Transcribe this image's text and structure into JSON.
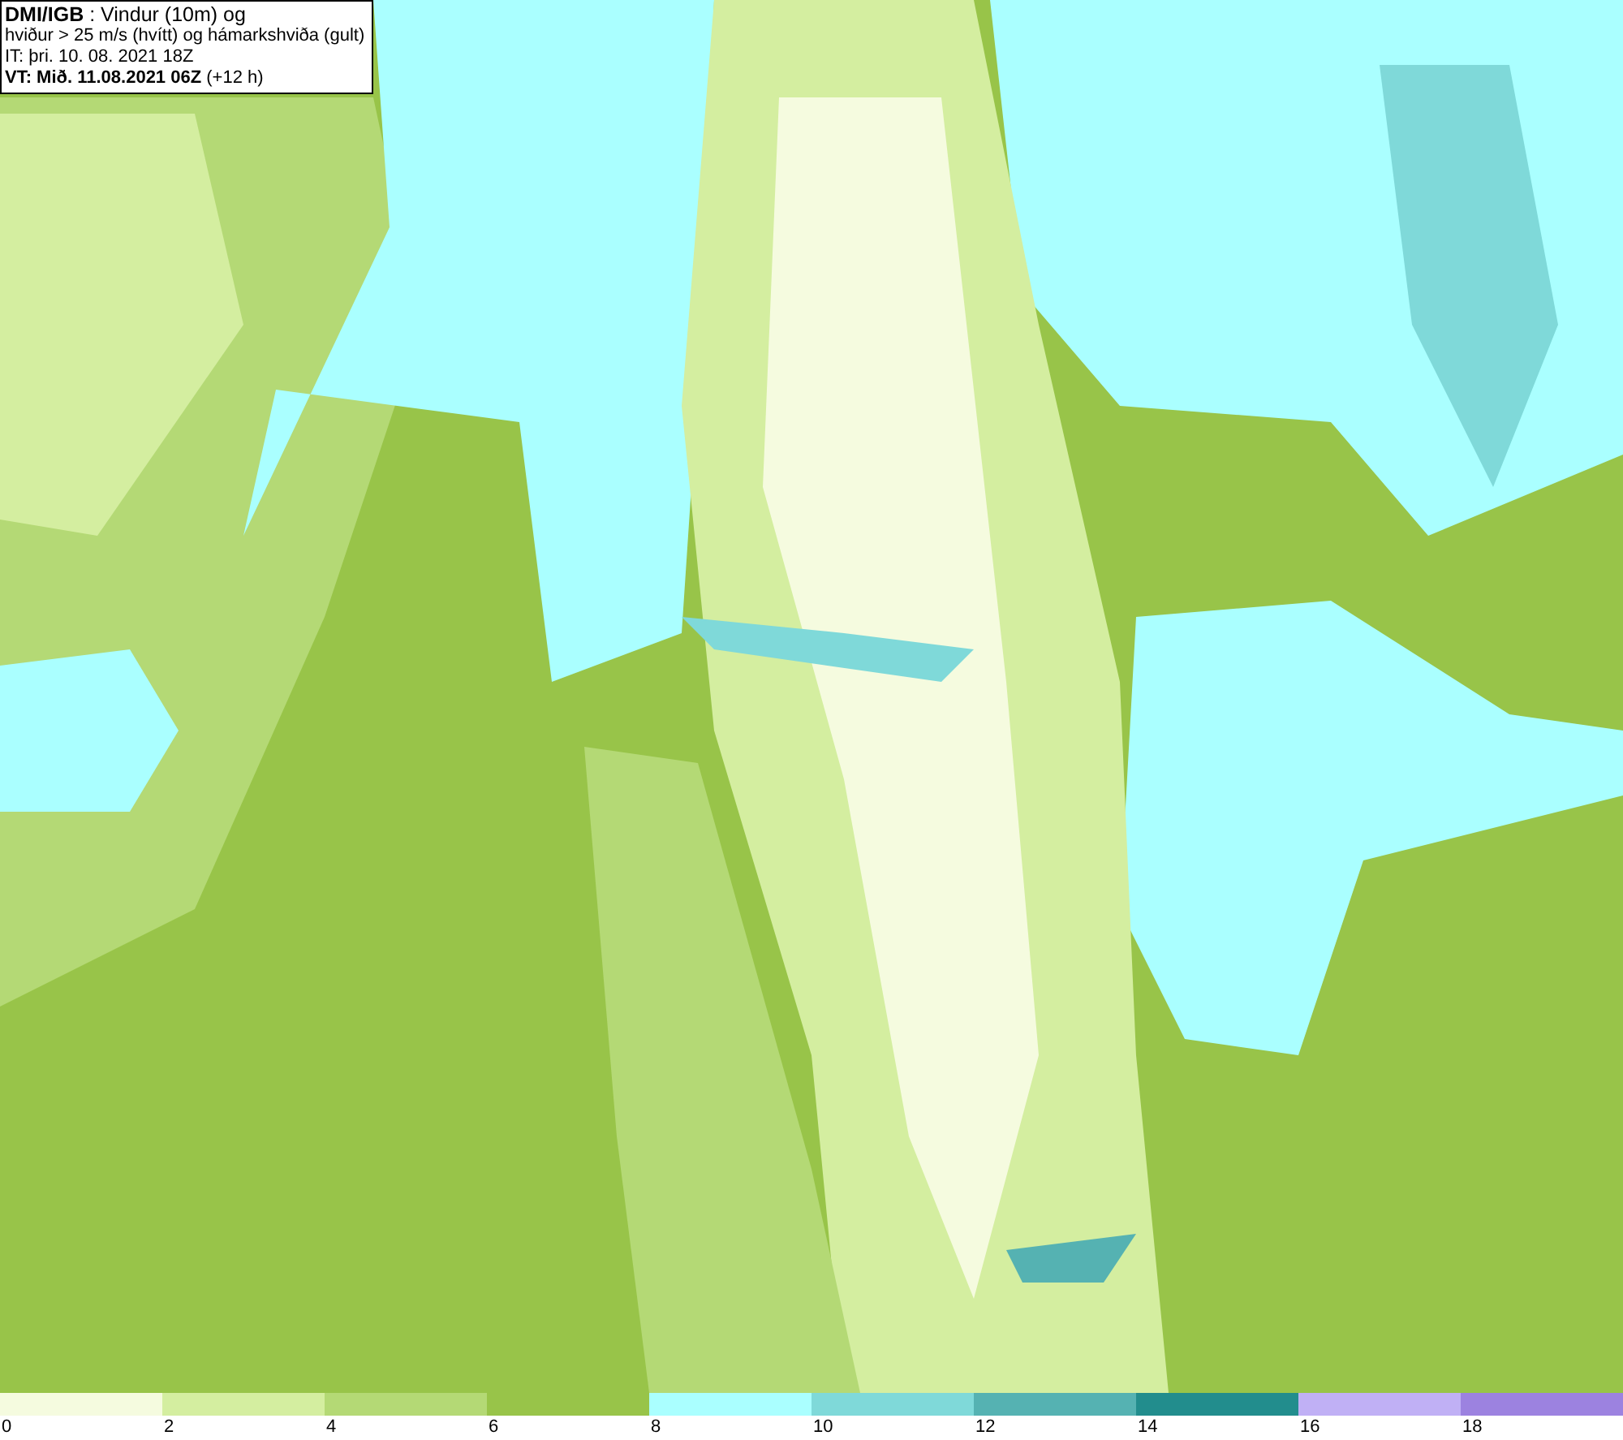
{
  "header": {
    "lines": [
      "**DMI/IGB** : Vindur (10m) og",
      "hviður > 25 m/s (hvítt) og hámarkshviða (gult)",
      "IT: þri. 10. 08. 2021 18Z",
      "**VT: Mið. 11.08.2021 06Z** (+12 h)"
    ]
  },
  "legend": [
    {
      "label": "0",
      "color": "#f5fbdf"
    },
    {
      "label": "2",
      "color": "#d4eea0"
    },
    {
      "label": "4",
      "color": "#b4d975"
    },
    {
      "label": "6",
      "color": "#98c449"
    },
    {
      "label": "8",
      "color": "#aaffff"
    },
    {
      "label": "10",
      "color": "#7fd9d9"
    },
    {
      "label": "12",
      "color": "#55b2b2"
    },
    {
      "label": "14",
      "color": "#228d8d"
    },
    {
      "label": "16",
      "color": "#c0b0f5"
    },
    {
      "label": "18",
      "color": "#9c82e0"
    }
  ]
}
